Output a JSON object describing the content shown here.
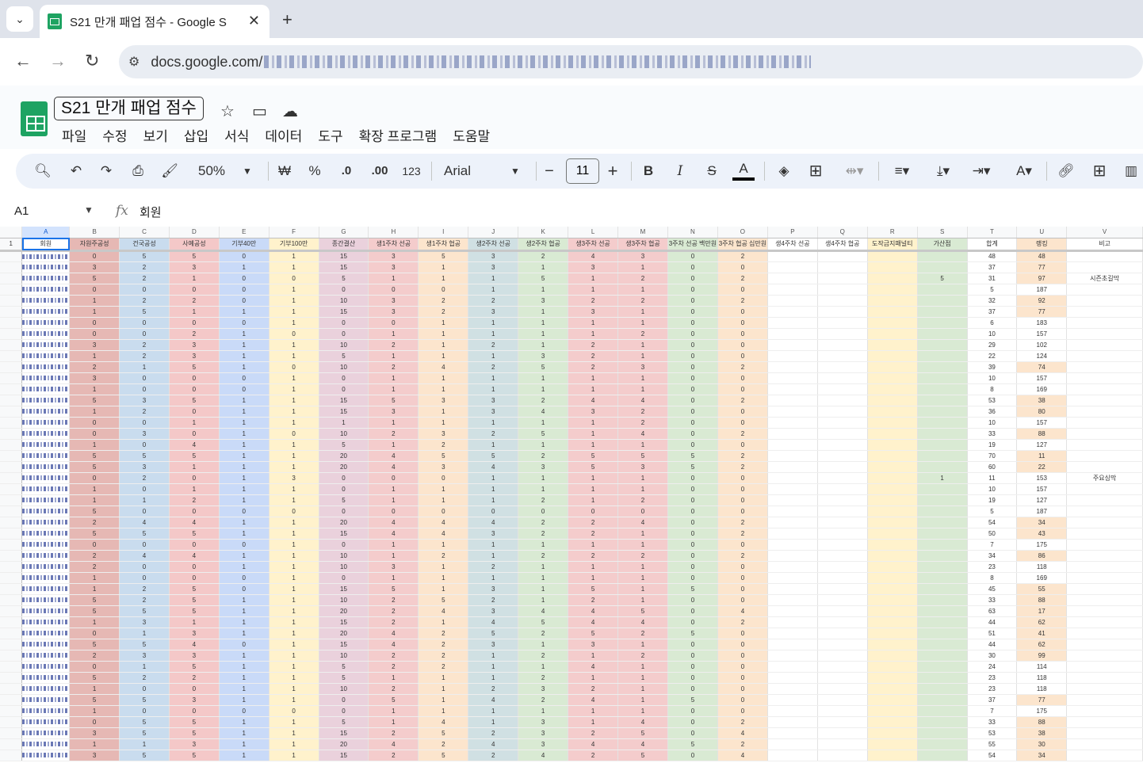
{
  "browser": {
    "tab_title": "S21 만개 패업 점수 - Google S",
    "url": "docs.google.com/"
  },
  "doc": {
    "title": "S21 만개 패업 점수",
    "menus": [
      "파일",
      "수정",
      "보기",
      "삽입",
      "서식",
      "데이터",
      "도구",
      "확장 프로그램",
      "도움말"
    ]
  },
  "toolbar": {
    "zoom": "50%",
    "currency": "₩",
    "percent": "%",
    "dec_less": ".0",
    "dec_more": ".00",
    "number_format": "123",
    "font": "Arial",
    "font_size": "11",
    "bold": "B",
    "italic": "I",
    "strike": "S",
    "text_color": "A",
    "minus": "−",
    "plus": "+"
  },
  "formula_bar": {
    "cell_ref": "A1",
    "fx": "fx",
    "value": "회원"
  },
  "sheet": {
    "col_letters": [
      "A",
      "B",
      "C",
      "D",
      "E",
      "F",
      "G",
      "H",
      "I",
      "J",
      "K",
      "L",
      "M",
      "N",
      "O",
      "P",
      "Q",
      "R",
      "S",
      "T",
      "U",
      "V"
    ],
    "headers": [
      "회원",
      "자원주공성",
      "건국공성",
      "사예공성",
      "기부40만",
      "기부100만",
      "종간결산",
      "생1주차 선공",
      "생1주차 협공",
      "생2주차 선공",
      "생2주차 협공",
      "생3주차 선공",
      "생3주차 협공",
      "3주차 선공 백만원",
      "3주차 협공 십만원",
      "생4주차 선공",
      "생4주차 협공",
      "도작금지패널티",
      "가산점",
      "합계",
      "랭킹",
      "비고"
    ],
    "header_row_number": "1",
    "col_colors": [
      "#ffffff",
      "#e6b8b4",
      "#c9dcee",
      "#f4c8c8",
      "#c9daf8",
      "#fff2cc",
      "#ead1dc",
      "#f4cccc",
      "#fce5cd",
      "#d0e0e3",
      "#d9ead3",
      "#f4cccc",
      "#f4cccc",
      "#d9ead3",
      "#fce5cd",
      "#ffffff",
      "#ffffff",
      "#fff2cc",
      "#d9ead3",
      "#ffffff",
      "#fce5cd",
      "#ffffff"
    ],
    "highlight_rank_color": "#fce5cd",
    "rows": [
      [
        "0",
        "5",
        "5",
        "0",
        "1",
        "15",
        "3",
        "5",
        "3",
        "2",
        "4",
        "3",
        "0",
        "2",
        "",
        "",
        "",
        "",
        "48",
        "48",
        ""
      ],
      [
        "3",
        "2",
        "3",
        "1",
        "1",
        "15",
        "3",
        "1",
        "3",
        "1",
        "3",
        "1",
        "0",
        "0",
        "",
        "",
        "",
        "",
        "37",
        "77",
        ""
      ],
      [
        "5",
        "2",
        "1",
        "0",
        "0",
        "5",
        "1",
        "1",
        "1",
        "5",
        "1",
        "2",
        "0",
        "2",
        "",
        "",
        "",
        "5",
        "31",
        "97",
        "시즌초길막"
      ],
      [
        "0",
        "0",
        "0",
        "0",
        "1",
        "0",
        "0",
        "0",
        "1",
        "1",
        "1",
        "1",
        "0",
        "0",
        "",
        "",
        "",
        "",
        "5",
        "187",
        ""
      ],
      [
        "1",
        "2",
        "2",
        "0",
        "1",
        "10",
        "3",
        "2",
        "2",
        "3",
        "2",
        "2",
        "0",
        "2",
        "",
        "",
        "",
        "",
        "32",
        "92",
        ""
      ],
      [
        "1",
        "5",
        "1",
        "1",
        "1",
        "15",
        "3",
        "2",
        "3",
        "1",
        "3",
        "1",
        "0",
        "0",
        "",
        "",
        "",
        "",
        "37",
        "77",
        ""
      ],
      [
        "0",
        "0",
        "0",
        "0",
        "1",
        "0",
        "0",
        "1",
        "1",
        "1",
        "1",
        "1",
        "0",
        "0",
        "",
        "",
        "",
        "",
        "6",
        "183",
        ""
      ],
      [
        "0",
        "0",
        "2",
        "1",
        "0",
        "0",
        "1",
        "1",
        "1",
        "1",
        "1",
        "2",
        "0",
        "0",
        "",
        "",
        "",
        "",
        "10",
        "157",
        ""
      ],
      [
        "3",
        "2",
        "3",
        "1",
        "1",
        "10",
        "2",
        "1",
        "2",
        "1",
        "2",
        "1",
        "0",
        "0",
        "",
        "",
        "",
        "",
        "29",
        "102",
        ""
      ],
      [
        "1",
        "2",
        "3",
        "1",
        "1",
        "5",
        "1",
        "1",
        "1",
        "3",
        "2",
        "1",
        "0",
        "0",
        "",
        "",
        "",
        "",
        "22",
        "124",
        ""
      ],
      [
        "2",
        "1",
        "5",
        "1",
        "0",
        "10",
        "2",
        "4",
        "2",
        "5",
        "2",
        "3",
        "0",
        "2",
        "",
        "",
        "",
        "",
        "39",
        "74",
        ""
      ],
      [
        "3",
        "0",
        "0",
        "0",
        "1",
        "0",
        "1",
        "1",
        "1",
        "1",
        "1",
        "1",
        "0",
        "0",
        "",
        "",
        "",
        "",
        "10",
        "157",
        ""
      ],
      [
        "1",
        "0",
        "0",
        "0",
        "1",
        "0",
        "1",
        "1",
        "1",
        "1",
        "1",
        "1",
        "0",
        "0",
        "",
        "",
        "",
        "",
        "8",
        "169",
        ""
      ],
      [
        "5",
        "3",
        "5",
        "1",
        "1",
        "15",
        "5",
        "3",
        "3",
        "2",
        "4",
        "4",
        "0",
        "2",
        "",
        "",
        "",
        "",
        "53",
        "38",
        ""
      ],
      [
        "1",
        "2",
        "0",
        "1",
        "1",
        "15",
        "3",
        "1",
        "3",
        "4",
        "3",
        "2",
        "0",
        "0",
        "",
        "",
        "",
        "",
        "36",
        "80",
        ""
      ],
      [
        "0",
        "0",
        "1",
        "1",
        "1",
        "1",
        "1",
        "1",
        "1",
        "1",
        "1",
        "2",
        "0",
        "0",
        "",
        "",
        "",
        "",
        "10",
        "157",
        ""
      ],
      [
        "0",
        "3",
        "0",
        "1",
        "0",
        "10",
        "2",
        "3",
        "2",
        "5",
        "1",
        "4",
        "0",
        "2",
        "",
        "",
        "",
        "",
        "33",
        "88",
        ""
      ],
      [
        "1",
        "0",
        "4",
        "1",
        "1",
        "5",
        "1",
        "2",
        "1",
        "1",
        "1",
        "1",
        "0",
        "0",
        "",
        "",
        "",
        "",
        "19",
        "127",
        ""
      ],
      [
        "5",
        "5",
        "5",
        "1",
        "1",
        "20",
        "4",
        "5",
        "5",
        "2",
        "5",
        "5",
        "5",
        "2",
        "",
        "",
        "",
        "",
        "70",
        "11",
        ""
      ],
      [
        "5",
        "3",
        "1",
        "1",
        "1",
        "20",
        "4",
        "3",
        "4",
        "3",
        "5",
        "3",
        "5",
        "2",
        "",
        "",
        "",
        "",
        "60",
        "22",
        ""
      ],
      [
        "0",
        "2",
        "0",
        "1",
        "3",
        "0",
        "0",
        "0",
        "1",
        "1",
        "1",
        "1",
        "0",
        "0",
        "",
        "",
        "",
        "1",
        "11",
        "153",
        "주요싱막"
      ],
      [
        "1",
        "0",
        "1",
        "1",
        "1",
        "0",
        "1",
        "1",
        "1",
        "1",
        "1",
        "1",
        "0",
        "0",
        "",
        "",
        "",
        "",
        "10",
        "157",
        ""
      ],
      [
        "1",
        "1",
        "2",
        "1",
        "1",
        "5",
        "1",
        "1",
        "1",
        "2",
        "1",
        "2",
        "0",
        "0",
        "",
        "",
        "",
        "",
        "19",
        "127",
        ""
      ],
      [
        "5",
        "0",
        "0",
        "0",
        "0",
        "0",
        "0",
        "0",
        "0",
        "0",
        "0",
        "0",
        "0",
        "0",
        "",
        "",
        "",
        "",
        "5",
        "187",
        ""
      ],
      [
        "2",
        "4",
        "4",
        "1",
        "1",
        "20",
        "4",
        "4",
        "4",
        "2",
        "2",
        "4",
        "0",
        "2",
        "",
        "",
        "",
        "",
        "54",
        "34",
        ""
      ],
      [
        "5",
        "5",
        "5",
        "1",
        "1",
        "15",
        "4",
        "4",
        "3",
        "2",
        "2",
        "1",
        "0",
        "2",
        "",
        "",
        "",
        "",
        "50",
        "43",
        ""
      ],
      [
        "0",
        "0",
        "0",
        "0",
        "1",
        "0",
        "1",
        "1",
        "1",
        "1",
        "1",
        "1",
        "0",
        "0",
        "",
        "",
        "",
        "",
        "7",
        "175",
        ""
      ],
      [
        "2",
        "4",
        "4",
        "1",
        "1",
        "10",
        "1",
        "2",
        "1",
        "2",
        "2",
        "2",
        "0",
        "2",
        "",
        "",
        "",
        "",
        "34",
        "86",
        ""
      ],
      [
        "2",
        "0",
        "0",
        "1",
        "1",
        "10",
        "3",
        "1",
        "2",
        "1",
        "1",
        "1",
        "0",
        "0",
        "",
        "",
        "",
        "",
        "23",
        "118",
        ""
      ],
      [
        "1",
        "0",
        "0",
        "0",
        "1",
        "0",
        "1",
        "1",
        "1",
        "1",
        "1",
        "1",
        "0",
        "0",
        "",
        "",
        "",
        "",
        "8",
        "169",
        ""
      ],
      [
        "1",
        "2",
        "5",
        "0",
        "1",
        "15",
        "5",
        "1",
        "3",
        "1",
        "5",
        "1",
        "5",
        "0",
        "",
        "",
        "",
        "",
        "45",
        "55",
        ""
      ],
      [
        "5",
        "2",
        "5",
        "1",
        "1",
        "10",
        "2",
        "5",
        "2",
        "1",
        "2",
        "1",
        "0",
        "0",
        "",
        "",
        "",
        "",
        "33",
        "88",
        ""
      ],
      [
        "5",
        "5",
        "5",
        "1",
        "1",
        "20",
        "2",
        "4",
        "3",
        "4",
        "4",
        "5",
        "0",
        "4",
        "",
        "",
        "",
        "",
        "63",
        "17",
        ""
      ],
      [
        "1",
        "3",
        "1",
        "1",
        "1",
        "15",
        "2",
        "1",
        "4",
        "5",
        "4",
        "4",
        "0",
        "2",
        "",
        "",
        "",
        "",
        "44",
        "62",
        ""
      ],
      [
        "0",
        "1",
        "3",
        "1",
        "1",
        "20",
        "4",
        "2",
        "5",
        "2",
        "5",
        "2",
        "5",
        "0",
        "",
        "",
        "",
        "",
        "51",
        "41",
        ""
      ],
      [
        "5",
        "5",
        "4",
        "0",
        "1",
        "15",
        "4",
        "2",
        "3",
        "1",
        "3",
        "1",
        "0",
        "0",
        "",
        "",
        "",
        "",
        "44",
        "62",
        ""
      ],
      [
        "2",
        "3",
        "3",
        "1",
        "1",
        "10",
        "2",
        "2",
        "1",
        "2",
        "1",
        "2",
        "0",
        "0",
        "",
        "",
        "",
        "",
        "30",
        "99",
        ""
      ],
      [
        "0",
        "1",
        "5",
        "1",
        "1",
        "5",
        "2",
        "2",
        "1",
        "1",
        "4",
        "1",
        "0",
        "0",
        "",
        "",
        "",
        "",
        "24",
        "114",
        ""
      ],
      [
        "5",
        "2",
        "2",
        "1",
        "1",
        "5",
        "1",
        "1",
        "1",
        "2",
        "1",
        "1",
        "0",
        "0",
        "",
        "",
        "",
        "",
        "23",
        "118",
        ""
      ],
      [
        "1",
        "0",
        "0",
        "1",
        "1",
        "10",
        "2",
        "1",
        "2",
        "3",
        "2",
        "1",
        "0",
        "0",
        "",
        "",
        "",
        "",
        "23",
        "118",
        ""
      ],
      [
        "5",
        "5",
        "3",
        "1",
        "1",
        "0",
        "5",
        "1",
        "4",
        "2",
        "4",
        "1",
        "5",
        "0",
        "",
        "",
        "",
        "",
        "37",
        "77",
        ""
      ],
      [
        "1",
        "0",
        "0",
        "0",
        "0",
        "0",
        "1",
        "1",
        "1",
        "1",
        "1",
        "1",
        "0",
        "0",
        "",
        "",
        "",
        "",
        "7",
        "175",
        ""
      ],
      [
        "0",
        "5",
        "5",
        "1",
        "1",
        "5",
        "1",
        "4",
        "1",
        "3",
        "1",
        "4",
        "0",
        "2",
        "",
        "",
        "",
        "",
        "33",
        "88",
        ""
      ],
      [
        "3",
        "5",
        "5",
        "1",
        "1",
        "15",
        "2",
        "5",
        "2",
        "3",
        "2",
        "5",
        "0",
        "4",
        "",
        "",
        "",
        "",
        "53",
        "38",
        ""
      ],
      [
        "1",
        "1",
        "3",
        "1",
        "1",
        "20",
        "4",
        "2",
        "4",
        "3",
        "4",
        "4",
        "5",
        "2",
        "",
        "",
        "",
        "",
        "55",
        "30",
        ""
      ],
      [
        "3",
        "5",
        "5",
        "1",
        "1",
        "15",
        "2",
        "5",
        "2",
        "4",
        "2",
        "5",
        "0",
        "4",
        "",
        "",
        "",
        "",
        "54",
        "34",
        ""
      ]
    ]
  }
}
